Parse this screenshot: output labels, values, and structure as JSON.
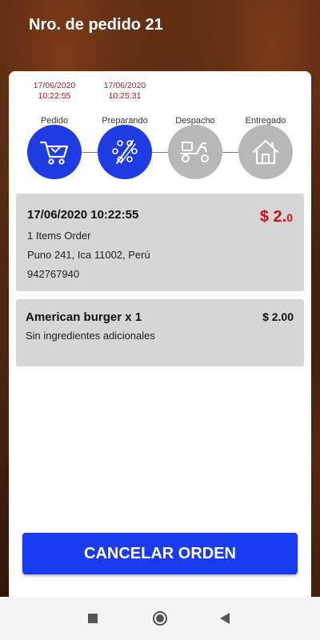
{
  "header": {
    "title": "Nro. de pedido 21"
  },
  "steps": [
    {
      "date": "17/06/2020",
      "time": "10:22:55",
      "label": "Pedido",
      "icon": "cart-icon",
      "active": true
    },
    {
      "date": "17/06/2020",
      "time": "10:25:31",
      "label": "Preparando",
      "icon": "food-prep-icon",
      "active": true
    },
    {
      "date": "",
      "time": "",
      "label": "Despacho",
      "icon": "delivery-scooter-icon",
      "active": false
    },
    {
      "date": "",
      "time": "",
      "label": "Entregado",
      "icon": "home-icon",
      "active": false
    }
  ],
  "order": {
    "datetime": "17/06/2020 10:22:55",
    "price_main": "$ 2.",
    "price_decimal": "0",
    "items_count": "1 Items Order",
    "address": "Puno 241, Ica 11002, Perú",
    "phone": "942767940"
  },
  "item": {
    "name": "American burger x 1",
    "price": "$ 2.00",
    "description": "Sin ingredientes adicionales"
  },
  "actions": {
    "cancel_label": "CANCELAR ORDEN"
  },
  "colors": {
    "accent": "#1a3cf0",
    "price_red": "#c4151c",
    "inactive": "#b8b8b8"
  }
}
